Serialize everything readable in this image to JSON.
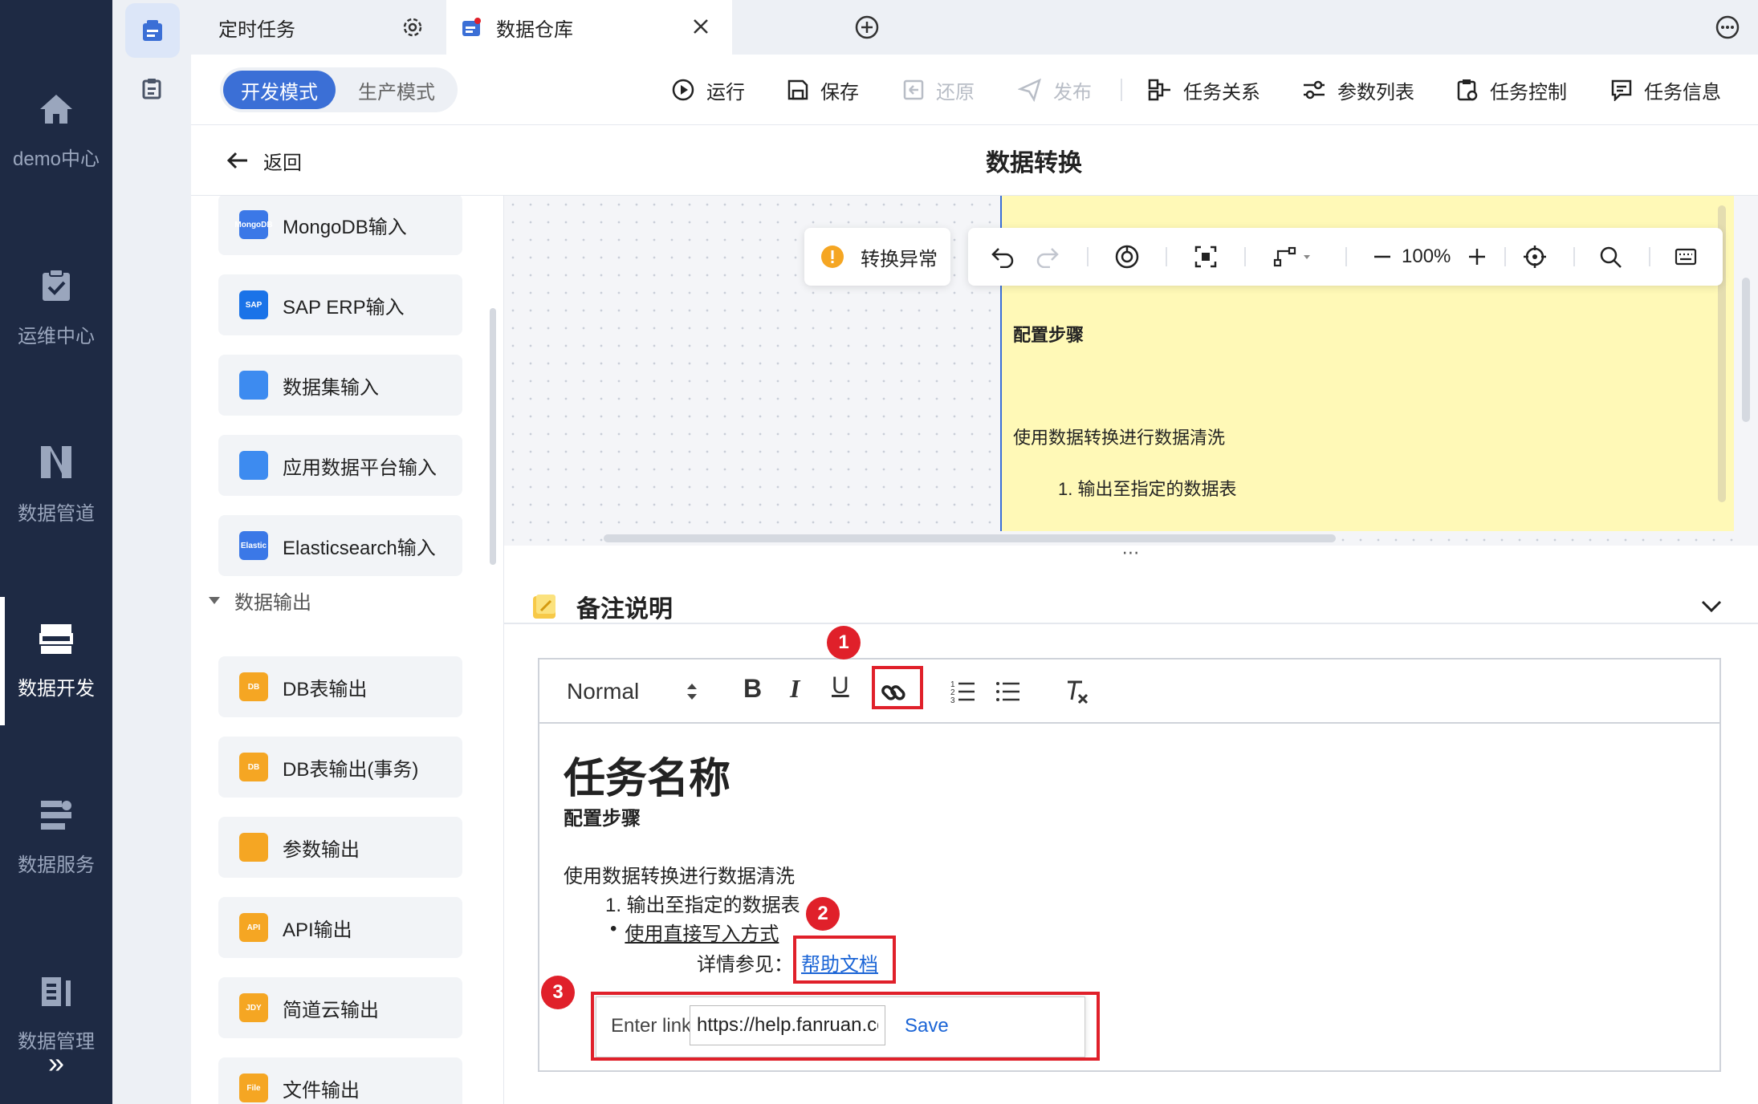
{
  "left_nav": {
    "items": [
      {
        "label": "demo中心",
        "icon": "home-icon"
      },
      {
        "label": "运维中心",
        "icon": "clipboard-check-icon"
      },
      {
        "label": "数据管道",
        "icon": "pipeline-icon"
      },
      {
        "label": "数据开发",
        "icon": "data-dev-icon",
        "active": true
      },
      {
        "label": "数据服务",
        "icon": "data-service-icon"
      },
      {
        "label": "数据管理",
        "icon": "data-manage-icon"
      }
    ],
    "collapse_glyph": "»"
  },
  "tabs": [
    {
      "label": "定时任务",
      "active": false
    },
    {
      "label": "数据仓库",
      "active": true
    }
  ],
  "toolbar": {
    "mode_dev": "开发模式",
    "mode_prod": "生产模式",
    "run": "运行",
    "save": "保存",
    "restore": "还原",
    "publish": "发布",
    "task_relation": "任务关系",
    "param_list": "参数列表",
    "task_control": "任务控制",
    "task_info": "任务信息"
  },
  "titlebar": {
    "back": "返回",
    "title": "数据转换"
  },
  "components": {
    "inputs": [
      {
        "label": "MongoDB输入",
        "icon_text": "MongoDB",
        "color": "#3b78e7"
      },
      {
        "label": "SAP ERP输入",
        "icon_text": "SAP",
        "color": "#1a73e8"
      },
      {
        "label": "数据集输入",
        "icon_text": "",
        "color": "#3d8bf0"
      },
      {
        "label": "应用数据平台输入",
        "icon_text": "",
        "color": "#3d8bf0"
      },
      {
        "label": "Elasticsearch输入",
        "icon_text": "Elastic",
        "color": "#3b78e7"
      }
    ],
    "output_group": "数据输出",
    "outputs": [
      {
        "label": "DB表输出",
        "icon_text": "DB",
        "color": "#f5a623"
      },
      {
        "label": "DB表输出(事务)",
        "icon_text": "DB",
        "color": "#f5a623"
      },
      {
        "label": "参数输出",
        "icon_text": "",
        "color": "#f5a623"
      },
      {
        "label": "API输出",
        "icon_text": "API",
        "color": "#f5a623"
      },
      {
        "label": "简道云输出",
        "icon_text": "JDY",
        "color": "#f5a623"
      },
      {
        "label": "文件输出",
        "icon_text": "File",
        "color": "#f5a623"
      }
    ]
  },
  "canvas": {
    "warning": "转换异常",
    "zoom": "100%",
    "note": {
      "heading": "配置步骤",
      "line1": "使用数据转换进行数据清洗",
      "line2": "1. 输出至指定的数据表"
    }
  },
  "remark": {
    "title": "备注说明",
    "format_select": "Normal",
    "content": {
      "h1": "任务名称",
      "h2": "配置步骤",
      "p1": "使用数据转换进行数据清洗",
      "ol1": "1. 输出至指定的数据表",
      "ul1": "使用直接写入方式",
      "detail_prefix": "详情参见：",
      "link_text": "帮助文档"
    },
    "link_editor": {
      "label": "Enter link:",
      "value": "https://help.fanruan.com/",
      "save": "Save"
    },
    "badges": [
      "1",
      "2",
      "3"
    ]
  },
  "colors": {
    "nav_bg": "#1e2a44",
    "accent": "#3b6fd6",
    "note_bg": "#fff9b7",
    "highlight_red": "#e0202a"
  }
}
